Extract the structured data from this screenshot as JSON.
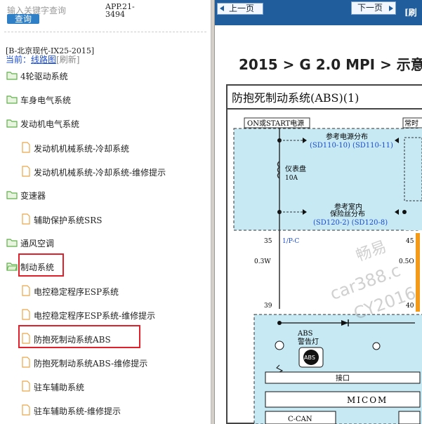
{
  "search": {
    "placeholder": "输入关键字查询",
    "button": "查询"
  },
  "app_version": "APP.21-3494",
  "vehicle": "[B-北京现代-IX25-2015]",
  "current": {
    "label": "当前：",
    "link": "线路图",
    "refresh": "[刷新]"
  },
  "tree": [
    {
      "label": "4轮驱动系统",
      "type": "folder"
    },
    {
      "label": "车身电气系统",
      "type": "folder"
    },
    {
      "label": "发动机电气系统",
      "type": "folder"
    },
    {
      "label": "发动机机械系统-冷却系统",
      "type": "file"
    },
    {
      "label": "发动机机械系统-冷却系统-维修提示",
      "type": "file"
    },
    {
      "label": "变速器",
      "type": "folder"
    },
    {
      "label": "辅助保护系统SRS",
      "type": "file"
    },
    {
      "label": "通风空调",
      "type": "folder"
    },
    {
      "label": "制动系统",
      "type": "folder-open"
    },
    {
      "label": "电控稳定程序ESP系统",
      "type": "file"
    },
    {
      "label": "电控稳定程序ESP系统-维修提示",
      "type": "file"
    },
    {
      "label": "防抱死制动系统ABS",
      "type": "file"
    },
    {
      "label": "防抱死制动系统ABS-维修提示",
      "type": "file"
    },
    {
      "label": "驻车辅助系统",
      "type": "file"
    },
    {
      "label": "驻车辅助系统-维修提示",
      "type": "file"
    }
  ],
  "viewer": {
    "prev": "上一页",
    "next": "下一页",
    "bar_label": "[刷",
    "breadcrumb": "2015 > G 2.0 MPI > 示意",
    "diagram_title": "防抱死制动系统(ABS)(1)",
    "watermark": [
      "畅易",
      "car388.c",
      "CY2016"
    ]
  },
  "diagram": {
    "power_left": "ON或START电源",
    "power_right": "常时",
    "ref_power": "参考电源分布",
    "ref_power_codes": "(SD110-10) (SD110-11)",
    "fuse_name": "仪表盘",
    "fuse_rating": "10A",
    "ref_fuse_1": "参考室内",
    "ref_fuse_2": "保险丝分布",
    "ref_fuse_codes": "(SD120-2) (SD120-8)",
    "pin_35": "35",
    "pin_45": "45",
    "wire_1": "1/P-C",
    "gauge_left": "0.3W",
    "gauge_right": "0.5O",
    "pin_39": "39",
    "pin_40": "40",
    "abs_lamp_1": "ABS",
    "abs_lamp_2": "警告灯",
    "abs_logo": "ABS",
    "interface": "接口",
    "micom": "MICOM",
    "ccan": "C-CAN"
  },
  "colors": {
    "highlight": "#e0202a",
    "query_button": "#2f7fc7",
    "diagram_fill": "#c6e9f4",
    "folder": "#5fb04a",
    "file": "#e9a84a",
    "wire_orange": "#f39a1a"
  }
}
